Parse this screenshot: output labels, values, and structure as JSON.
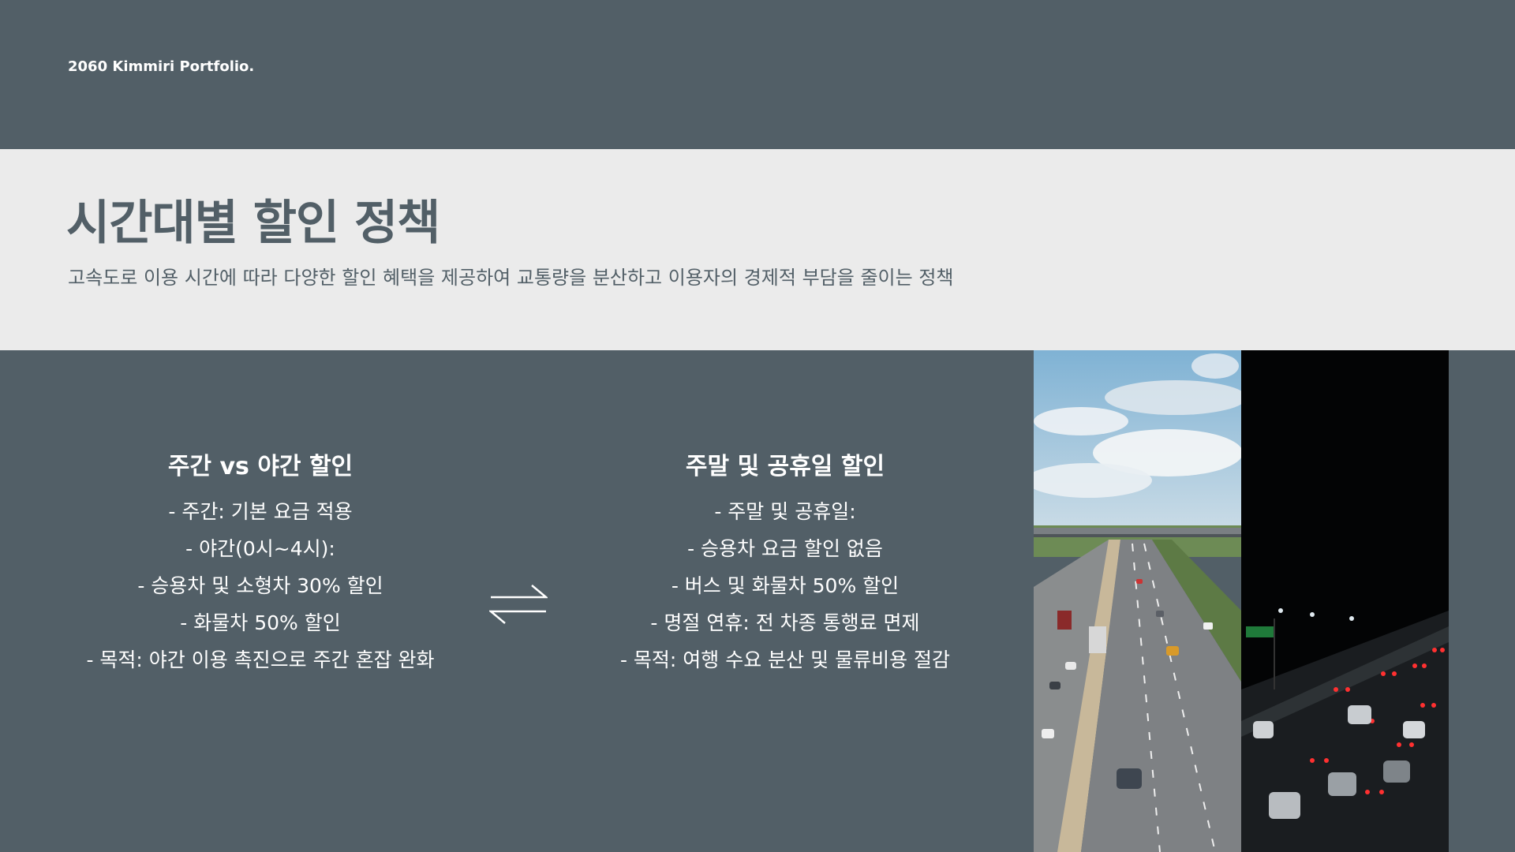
{
  "header": {
    "brand": "2060 Kimmiri Portfolio.",
    "title": "시간대별 할인 정책",
    "subtitle": "고속도로 이용 시간에 따라 다양한 할인 혜택을 제공하여 교통량을 분산하고 이용자의 경제적 부담을 줄이는 정책"
  },
  "left_column": {
    "title": "주간 vs 야간 할인",
    "lines": [
      "- 주간: 기본 요금 적용",
      "- 야간(0시~4시):",
      "- 승용차 및 소형차 30% 할인",
      "- 화물차 50% 할인",
      "- 목적: 야간 이용 촉진으로 주간 혼잡 완화"
    ]
  },
  "right_column": {
    "title": "주말 및 공휴일 할인",
    "lines": [
      "- 주말 및 공휴일:",
      "- 승용차 요금 할인 없음",
      "- 버스 및 화물차 50% 할인",
      "- 명절 연휴: 전 차종 통행료 면제",
      "- 목적: 여행 수요 분산 및 물류비용 절감"
    ]
  },
  "icons": {
    "swap": "swap-arrows-icon"
  },
  "colors": {
    "background": "#525f67",
    "header_band": "#ebebeb",
    "text_light": "#ffffff",
    "text_dark": "#525f67"
  }
}
